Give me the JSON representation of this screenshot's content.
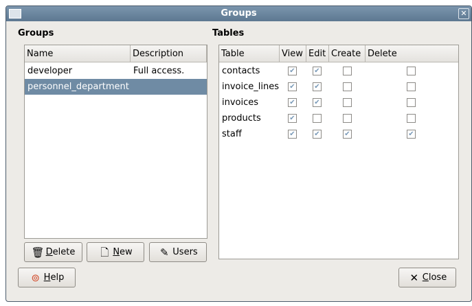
{
  "window": {
    "title": "Groups"
  },
  "groups": {
    "label": "Groups",
    "columns": [
      "Name",
      "Description"
    ],
    "rows": [
      {
        "name": "developer",
        "description": "Full access.",
        "selected": false
      },
      {
        "name": "personnel_department",
        "description": "",
        "selected": true
      }
    ],
    "buttons": {
      "delete": {
        "mn": "D",
        "rest": "elete"
      },
      "new": {
        "mn": "N",
        "rest": "ew"
      },
      "users": "Users"
    }
  },
  "tables": {
    "label": "Tables",
    "columns": [
      "Table",
      "View",
      "Edit",
      "Create",
      "Delete"
    ],
    "rows": [
      {
        "table": "contacts",
        "view": true,
        "edit": true,
        "create": false,
        "delete": false
      },
      {
        "table": "invoice_lines",
        "view": true,
        "edit": true,
        "create": false,
        "delete": false
      },
      {
        "table": "invoices",
        "view": true,
        "edit": true,
        "create": false,
        "delete": false
      },
      {
        "table": "products",
        "view": true,
        "edit": false,
        "create": false,
        "delete": false
      },
      {
        "table": "staff",
        "view": true,
        "edit": true,
        "create": true,
        "delete": true
      }
    ]
  },
  "footer": {
    "help": {
      "mn": "H",
      "rest": "elp"
    },
    "close": {
      "mn": "C",
      "rest": "lose"
    }
  }
}
